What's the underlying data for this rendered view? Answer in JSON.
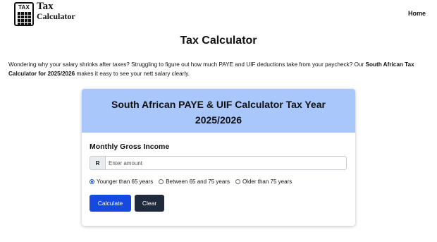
{
  "logo": {
    "badge": "TAX",
    "line1": "Tax",
    "line2": "Calculator"
  },
  "nav": {
    "home": "Home"
  },
  "page": {
    "title": "Tax Calculator"
  },
  "intro": {
    "text": "Wondering why your salary shrinks after taxes? Struggling to figure out how much PAYE and UIF deductions take from your paycheck? Our ",
    "bold": "South African Tax Calculator for 2025/2026",
    "text_end": " makes it easy to see your nett salary clearly."
  },
  "card": {
    "title_line1": "South African PAYE & UIF Calculator Tax Year",
    "title_line2": "2025/2026",
    "income_label": "Monthly Gross Income",
    "currency_prefix": "R",
    "amount_placeholder": "Enter amount",
    "amount_value": "",
    "age_options": [
      {
        "label": "Younger than 65 years",
        "checked": true
      },
      {
        "label": "Between 65 and 75 years",
        "checked": false
      },
      {
        "label": "Older than 75 years",
        "checked": false
      }
    ],
    "calculate_label": "Calculate",
    "clear_label": "Clear"
  },
  "colors": {
    "card_header": "#a9c7fb",
    "calculate_button": "#1549e0",
    "clear_button": "#1f2a3c",
    "radio_accent": "#1a56db"
  }
}
